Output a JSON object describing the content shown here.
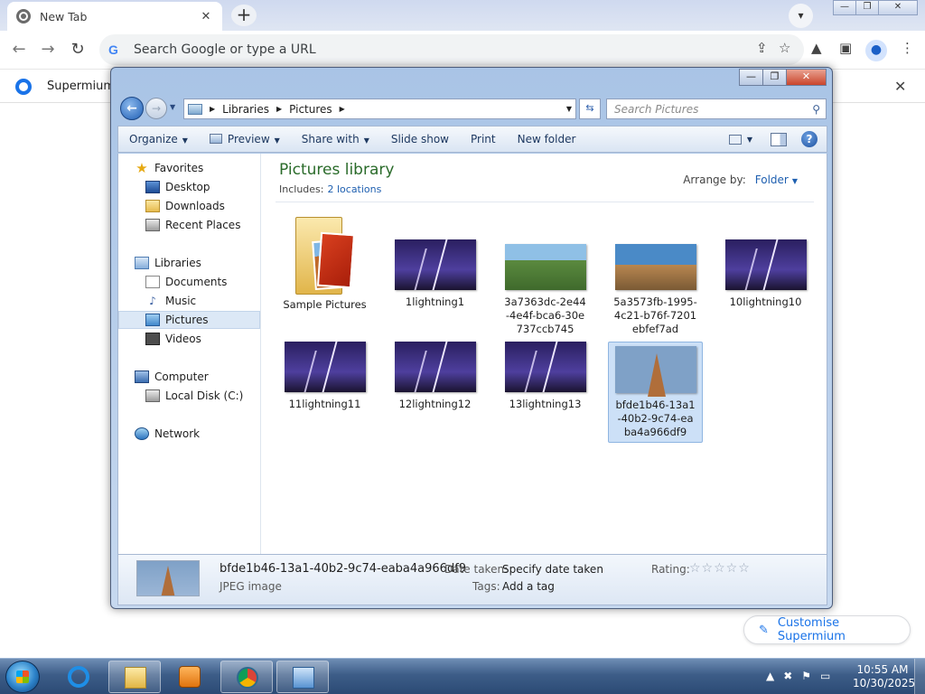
{
  "browser": {
    "tab_title": "New Tab",
    "tab_close": "✕",
    "new_tab": "+",
    "omnibox_placeholder": "Search Google or type a URL",
    "infobar_text": "Supermium",
    "customise_label": "Customise Supermium"
  },
  "explorer": {
    "breadcrumbs": [
      "Libraries",
      "Pictures"
    ],
    "search_placeholder": "Search Pictures",
    "commands": {
      "organize": "Organize",
      "preview": "Preview",
      "share_with": "Share with",
      "slide_show": "Slide show",
      "print": "Print",
      "new_folder": "New folder"
    },
    "nav": {
      "favorites": "Favorites",
      "desktop": "Desktop",
      "downloads": "Downloads",
      "recent_places": "Recent Places",
      "libraries": "Libraries",
      "documents": "Documents",
      "music": "Music",
      "pictures": "Pictures",
      "videos": "Videos",
      "computer": "Computer",
      "local_disk": "Local Disk (C:)",
      "network": "Network"
    },
    "library_title": "Pictures library",
    "includes_label": "Includes:",
    "includes_link": "2 locations",
    "arrange_label": "Arrange by:",
    "arrange_value": "Folder",
    "items": [
      {
        "name": "Sample Pictures"
      },
      {
        "name": "1lightning1"
      },
      {
        "name": "3a7363dc-2e44-4e4f-bca6-30e737ccb745"
      },
      {
        "name": "5a3573fb-1995-4c21-b76f-7201ebfef7ad"
      },
      {
        "name": "10lightning10"
      },
      {
        "name": "11lightning11"
      },
      {
        "name": "12lightning12"
      },
      {
        "name": "13lightning13"
      },
      {
        "name": "bfde1b46-13a1-40b2-9c74-eaba4a966df9"
      }
    ],
    "details": {
      "file_name": "bfde1b46-13a1-40b2-9c74-eaba4a966df9",
      "file_type": "JPEG image",
      "date_taken_label": "Date taken:",
      "date_taken_value": "Specify date taken",
      "tags_label": "Tags:",
      "tags_value": "Add a tag",
      "rating_label": "Rating:",
      "rating": 0
    }
  },
  "taskbar": {
    "time": "10:55 AM",
    "date": "10/30/2025"
  }
}
